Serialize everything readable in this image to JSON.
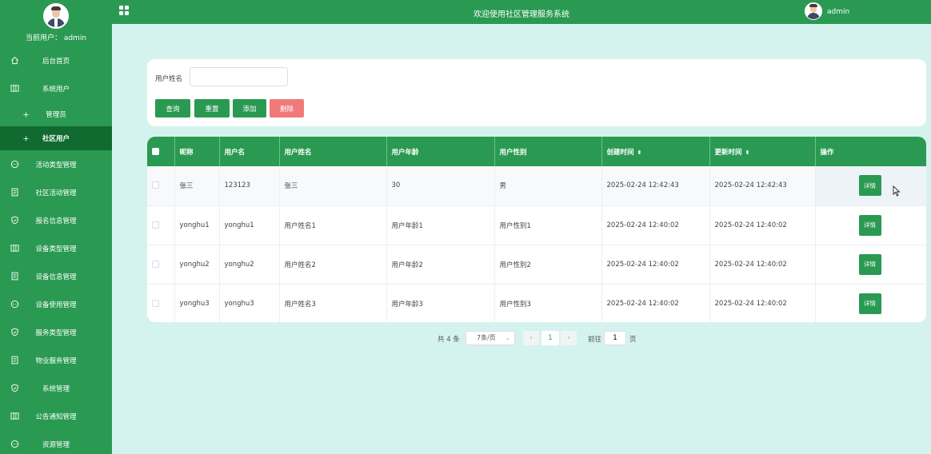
{
  "sidebar": {
    "current_user_label": "当前用户： admin",
    "items": [
      {
        "label": "后台首页",
        "icon": "home-icon"
      },
      {
        "label": "系统用户",
        "icon": "columns-icon"
      },
      {
        "label": "管理员",
        "icon": "plus-icon",
        "sub": true
      },
      {
        "label": "社区用户",
        "icon": "plus-icon",
        "sub": true,
        "active": true
      },
      {
        "label": "活动类型管理",
        "icon": "chat-icon"
      },
      {
        "label": "社区活动管理",
        "icon": "document-icon"
      },
      {
        "label": "报名信息管理",
        "icon": "shield-icon"
      },
      {
        "label": "设备类型管理",
        "icon": "columns-icon"
      },
      {
        "label": "设备信息管理",
        "icon": "document-icon"
      },
      {
        "label": "设备使用管理",
        "icon": "chat-icon"
      },
      {
        "label": "服务类型管理",
        "icon": "shield-icon"
      },
      {
        "label": "物业服务管理",
        "icon": "document-icon"
      },
      {
        "label": "系统管理",
        "icon": "shield-icon"
      },
      {
        "label": "公告通知管理",
        "icon": "columns-icon"
      },
      {
        "label": "资源管理",
        "icon": "chat-icon"
      }
    ]
  },
  "header": {
    "title": "欢迎使用社区管理服务系统",
    "user": "admin"
  },
  "search": {
    "label": "用户姓名",
    "value": "",
    "buttons": {
      "query": "查询",
      "reset": "重置",
      "add": "添加",
      "delete": "删除"
    }
  },
  "table": {
    "columns": [
      "昵称",
      "用户名",
      "用户姓名",
      "用户年龄",
      "用户性别",
      "创建时间",
      "更新时间",
      "操作"
    ],
    "sortable_marker": "⬍",
    "rows": [
      [
        "张三",
        "123123",
        "张三",
        "30",
        "男",
        "2025-02-24 12:42:43",
        "2025-02-24 12:42:43"
      ],
      [
        "yonghu1",
        "yonghu1",
        "用户姓名1",
        "用户年龄1",
        "用户性别1",
        "2025-02-24 12:40:02",
        "2025-02-24 12:40:02"
      ],
      [
        "yonghu2",
        "yonghu2",
        "用户姓名2",
        "用户年龄2",
        "用户性别2",
        "2025-02-24 12:40:02",
        "2025-02-24 12:40:02"
      ],
      [
        "yonghu3",
        "yonghu3",
        "用户姓名3",
        "用户年龄3",
        "用户性别3",
        "2025-02-24 12:40:02",
        "2025-02-24 12:40:02"
      ]
    ],
    "detail_label": "详情"
  },
  "pagination": {
    "total": "共 4 条",
    "page_size": "7条/页",
    "current_page": "1",
    "goto_label": "前往",
    "goto_value": "1",
    "page_suffix": "页"
  },
  "colors": {
    "primary": "#2a9a52",
    "active_menu": "#116a2f",
    "danger": "#f07a7a",
    "background": "#d5f3ee"
  }
}
